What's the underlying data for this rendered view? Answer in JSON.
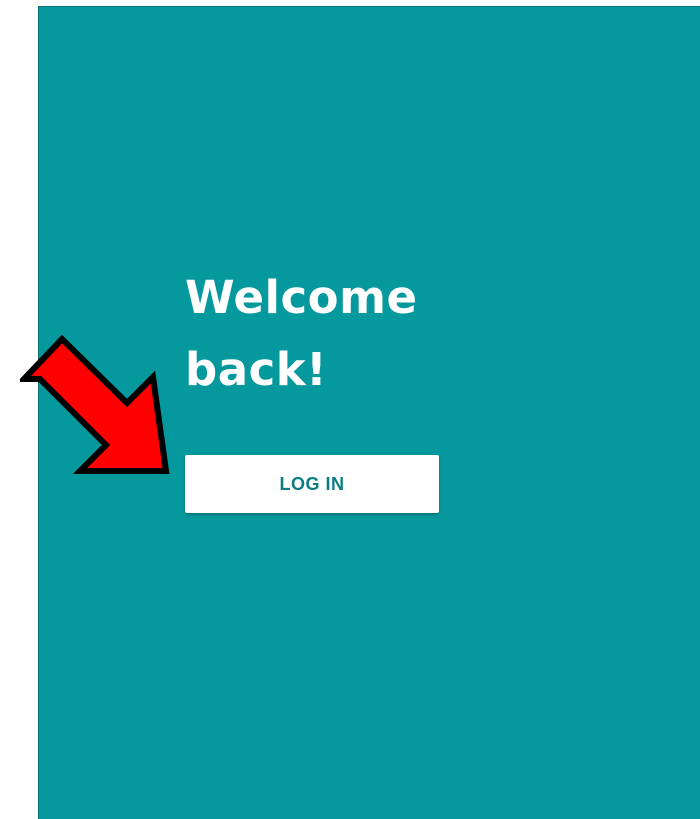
{
  "welcome": {
    "line1": "Welcome",
    "line2": "back!"
  },
  "login_button": {
    "label": "LOG IN"
  },
  "colors": {
    "panel_background": "#05999e",
    "button_text": "#0b7d82",
    "arrow_fill": "#ff0000"
  },
  "annotations": {
    "arrow_icon": "red-arrow-icon"
  }
}
